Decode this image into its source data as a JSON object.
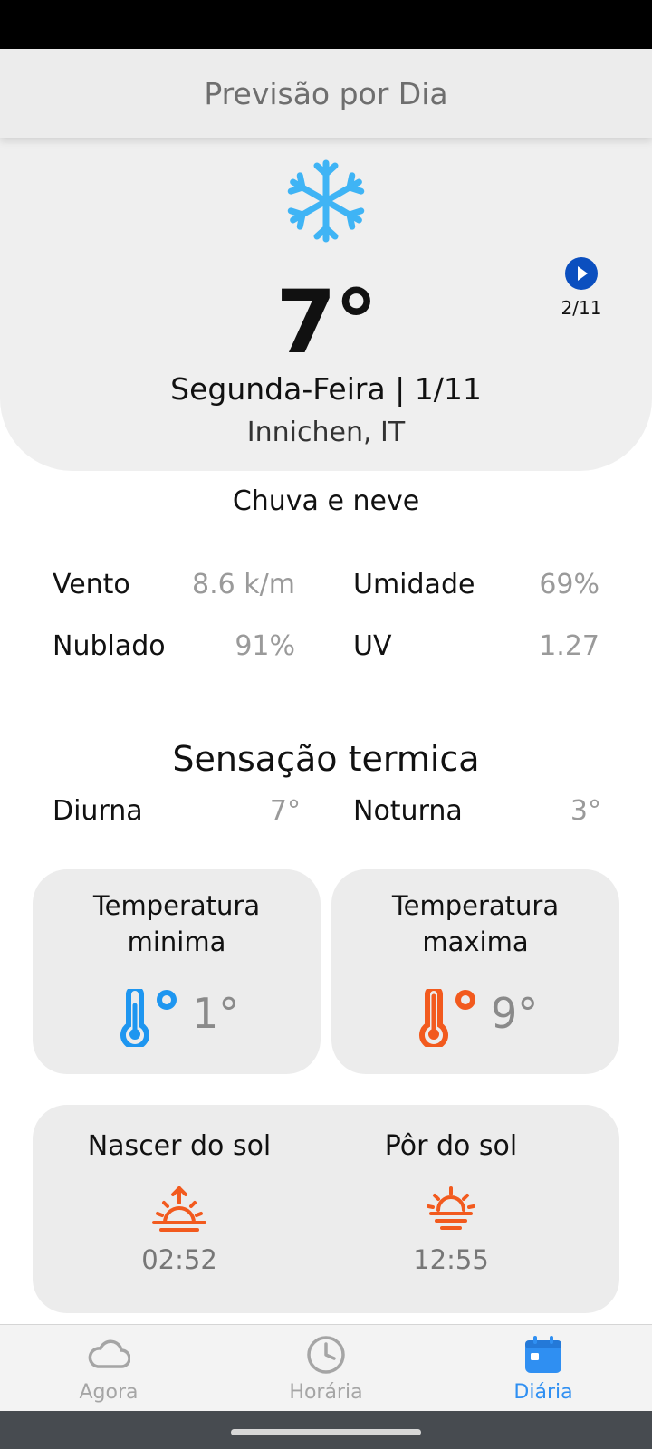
{
  "header": {
    "title": "Previsão por Dia"
  },
  "hero": {
    "icon": "snowflake-icon",
    "temperature": "7°",
    "date": "Segunda-Feira | 1/11",
    "location": "Innichen, IT",
    "next_day": {
      "icon": "play-arrow-icon",
      "label": "2/11"
    }
  },
  "condition": "Chuva e neve",
  "stats": [
    {
      "label": "Vento",
      "value": "8.6 k/m"
    },
    {
      "label": "Umidade",
      "value": "69%"
    },
    {
      "label": "Nublado",
      "value": "91%"
    },
    {
      "label": "UV",
      "value": "1.27"
    }
  ],
  "feels_like": {
    "title": "Sensação termica",
    "day": {
      "label": "Diurna",
      "value": "7°"
    },
    "night": {
      "label": "Noturna",
      "value": "3°"
    }
  },
  "min_temp": {
    "title_line1": "Temperatura",
    "title_line2": "minima",
    "value": "1°",
    "icon": "thermometer-cold-icon",
    "color": "#1e96f0"
  },
  "max_temp": {
    "title_line1": "Temperatura",
    "title_line2": "maxima",
    "value": "9°",
    "icon": "thermometer-hot-icon",
    "color": "#f25a1e"
  },
  "sun": {
    "sunrise": {
      "label": "Nascer do sol",
      "time": "02:52",
      "icon": "sunrise-icon"
    },
    "sunset": {
      "label": "Pôr do sol",
      "time": "12:55",
      "icon": "sunset-icon"
    },
    "color": "#f25a1e"
  },
  "nav": [
    {
      "label": "Agora",
      "icon": "cloud-icon",
      "active": false
    },
    {
      "label": "Horária",
      "icon": "clock-icon",
      "active": false
    },
    {
      "label": "Diária",
      "icon": "calendar-icon",
      "active": true
    }
  ],
  "colors": {
    "accent": "#2f8ff2",
    "snow": "#3fb4f5",
    "next_button": "#0b4fbf"
  }
}
